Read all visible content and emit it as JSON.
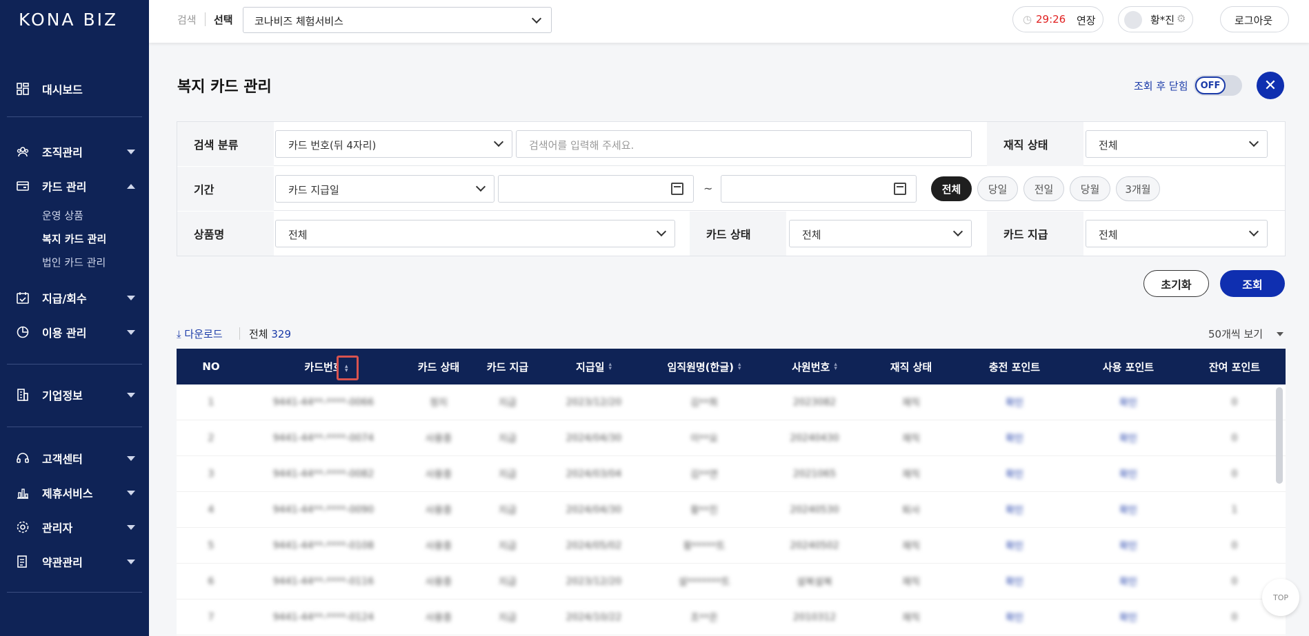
{
  "sidebar": {
    "logo": "KONA BIZ",
    "items": [
      {
        "label": "대시보드"
      },
      {
        "label": "조직관리"
      },
      {
        "label": "카드 관리"
      },
      {
        "label": "지급/회수"
      },
      {
        "label": "이용 관리"
      },
      {
        "label": "기업정보"
      },
      {
        "label": "고객센터"
      },
      {
        "label": "제휴서비스"
      },
      {
        "label": "관리자"
      },
      {
        "label": "약관관리"
      }
    ],
    "card_sub": [
      "운영 상품",
      "복지 카드 관리",
      "법인 카드 관리"
    ]
  },
  "topbar": {
    "search_label": "검색",
    "select_label": "선택",
    "company_select": "코나비즈 체험서비스",
    "timer": "29:26",
    "extend": "연장",
    "user": "황*진",
    "logout": "로그아웃"
  },
  "page": {
    "title": "복지 카드 관리",
    "close_after_label": "조회 후 닫힘",
    "toggle": "OFF",
    "close": "✕"
  },
  "filter": {
    "search_category_label": "검색 분류",
    "search_category_value": "카드 번호(뒤 4자리)",
    "search_placeholder": "검색어를 입력해 주세요.",
    "employment_label": "재직 상태",
    "employment_value": "전체",
    "period_label": "기간",
    "period_type": "카드 지급일",
    "tilde": "~",
    "period_chips": [
      "전체",
      "당일",
      "전일",
      "당월",
      "3개월"
    ],
    "product_label": "상품명",
    "product_value": "전체",
    "card_status_label": "카드 상태",
    "card_status_value": "전체",
    "card_issue_label": "카드 지급",
    "card_issue_value": "전체",
    "reset": "초기화",
    "search": "조회"
  },
  "list": {
    "download": "다운로드",
    "total_label": "전체",
    "total": "329",
    "per_page": "50개씩 보기",
    "headers": [
      "NO",
      "카드번호",
      "카드 상태",
      "카드 지급",
      "지급일",
      "임직원명(한글)",
      "사원번호",
      "재직 상태",
      "충전 포인트",
      "사용 포인트",
      "잔여 포인트"
    ],
    "rows": [
      [
        "1",
        "9441-44**-****-0066",
        "정지",
        "지급",
        "2023/12/20",
        "김**희",
        "2023082",
        "재직",
        "확인",
        "확인",
        "0"
      ],
      [
        "2",
        "9441-44**-****-0074",
        "사용중",
        "지급",
        "2024/04/30",
        "이**요",
        "20240430",
        "재직",
        "확인",
        "확인",
        "0"
      ],
      [
        "3",
        "9441-44**-****-0082",
        "사용중",
        "지급",
        "2024/03/04",
        "김**연",
        "2021065",
        "재직",
        "확인",
        "확인",
        "0"
      ],
      [
        "4",
        "9441-44**-****-0090",
        "사용중",
        "지급",
        "2024/04/30",
        "황**진",
        "20240530",
        "퇴사",
        "확인",
        "확인",
        "1"
      ],
      [
        "5",
        "9441-44**-****-0108",
        "사용중",
        "지급",
        "2024/05/02",
        "황*****트",
        "20240502",
        "재직",
        "확인",
        "확인",
        "0"
      ],
      [
        "6",
        "9441-44**-****-0116",
        "사용중",
        "지급",
        "2023/12/20",
        "설*******트",
        "설복설복",
        "재직",
        "확인",
        "확인",
        "0"
      ],
      [
        "7",
        "9441-44**-****-0124",
        "사용중",
        "지급",
        "2024/10/22",
        "조**은",
        "2010312",
        "재직",
        "확인",
        "확인",
        "0"
      ]
    ]
  },
  "top_button": "TOP"
}
